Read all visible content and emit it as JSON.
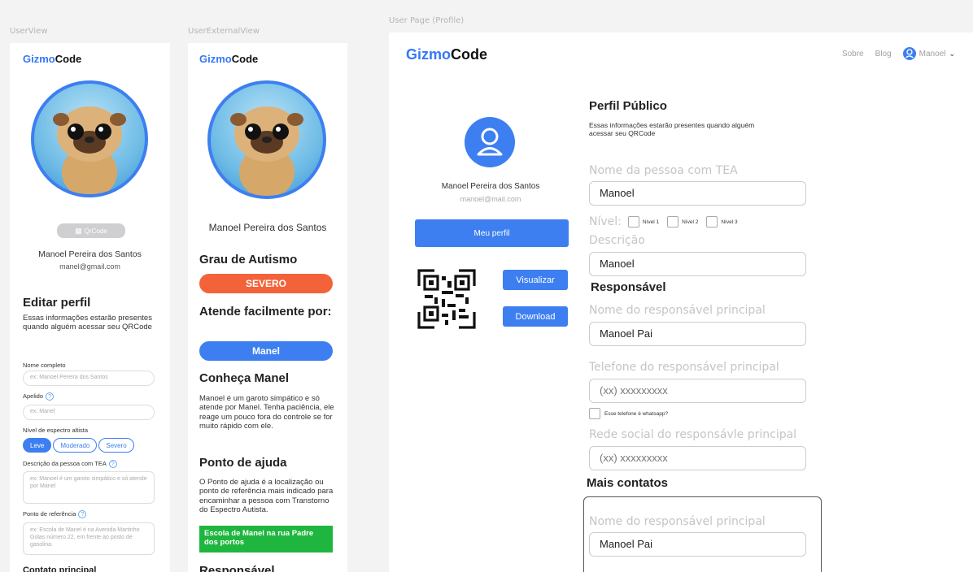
{
  "frames": {
    "user_view": "UserView",
    "user_external_view": "UserExternalView",
    "user_page": "User Page (Profile)"
  },
  "logo": {
    "part1": "Gizmo",
    "part2": "Code"
  },
  "user_view": {
    "qr_button": "QrCode",
    "name": "Manoel Pereira dos Santos",
    "email": "manel@gmail.com",
    "edit_title": "Editar perfil",
    "edit_desc": "Essas informações estarão presentes quando alguém acessar seu QRCode",
    "full_name_label": "Nome completo",
    "full_name_placeholder": "ex: Manoel Pereira dos Santos",
    "nickname_label": "Apelido",
    "nickname_placeholder": "ex: Manel",
    "spectrum_label": "Nível de espectro altista",
    "spectrum_options": [
      "Leve",
      "Moderado",
      "Severo"
    ],
    "desc_label": "Descrição da pessoa com TEA",
    "desc_placeholder": "ex: Manoel é um garoto simpático e só atende por Manel",
    "ref_label": "Ponto de referência",
    "ref_placeholder": "ex: Escola de Manel é na Avenida Martinho Golas número 22, em frente ao posto de gasolina.",
    "contact_title": "Contato principal",
    "help_icon": "?"
  },
  "external_view": {
    "name": "Manoel Pereira dos Santos",
    "grade_title": "Grau de Autismo",
    "grade_value": "SEVERO",
    "attends_title": "Atende facilmente por:",
    "attends_value": "Manel",
    "know_title": "Conheça Manel",
    "know_text": "Manoel é um garoto simpático e só atende por Manel. Tenha paciência, ele reage um pouco fora do controle se for muito rápido com ele.",
    "help_title": "Ponto de ajuda",
    "help_text": "O Ponto de ajuda é a localização ou ponto de referência mais indicado para encaminhar a pessoa com Transtorno do Espectro Autista.",
    "help_value": "Escola de Manel na rua Padre dos portos",
    "responsible_title": "Responsável",
    "colors": {
      "severe": "#f4623a",
      "blue": "#3d7ff0",
      "green": "#1fb63f"
    }
  },
  "user_page": {
    "nav": {
      "about": "Sobre",
      "blog": "Blog",
      "user": "Manoel"
    },
    "profile": {
      "name": "Manoel Pereira dos Santos",
      "email": "manoel@mail.com",
      "my_profile_button": "Meu perfil",
      "view_button": "Visualizar",
      "download_button": "Download"
    },
    "public_profile": {
      "title": "Perfil Público",
      "desc": "Essas informações estarão presentes quando alguém acessar seu QRCode",
      "person_label": "Nome da pessoa com TEA",
      "person_value": "Manoel",
      "level_label": "Nível:",
      "levels": [
        "Nível 1",
        "Nível 2",
        "Nível 3"
      ],
      "desc_label": "Descrição",
      "desc_value": "Manoel"
    },
    "responsible": {
      "title": "Responsável",
      "main_label": "Nome do responsável principal",
      "main_value": "Manoel Pai",
      "phone_label": "Telefone do responsável principal",
      "phone_value": "(xx) xxxxxxxxx",
      "whatsapp_label": "Esse telefone é whatsapp?",
      "social_label": "Rede social do responsávle principal",
      "social_value": "(xx) xxxxxxxxx"
    },
    "more_contacts": {
      "title": "Mais contatos",
      "main_label": "Nome do responsável principal",
      "main_value": "Manoel Pai"
    }
  }
}
